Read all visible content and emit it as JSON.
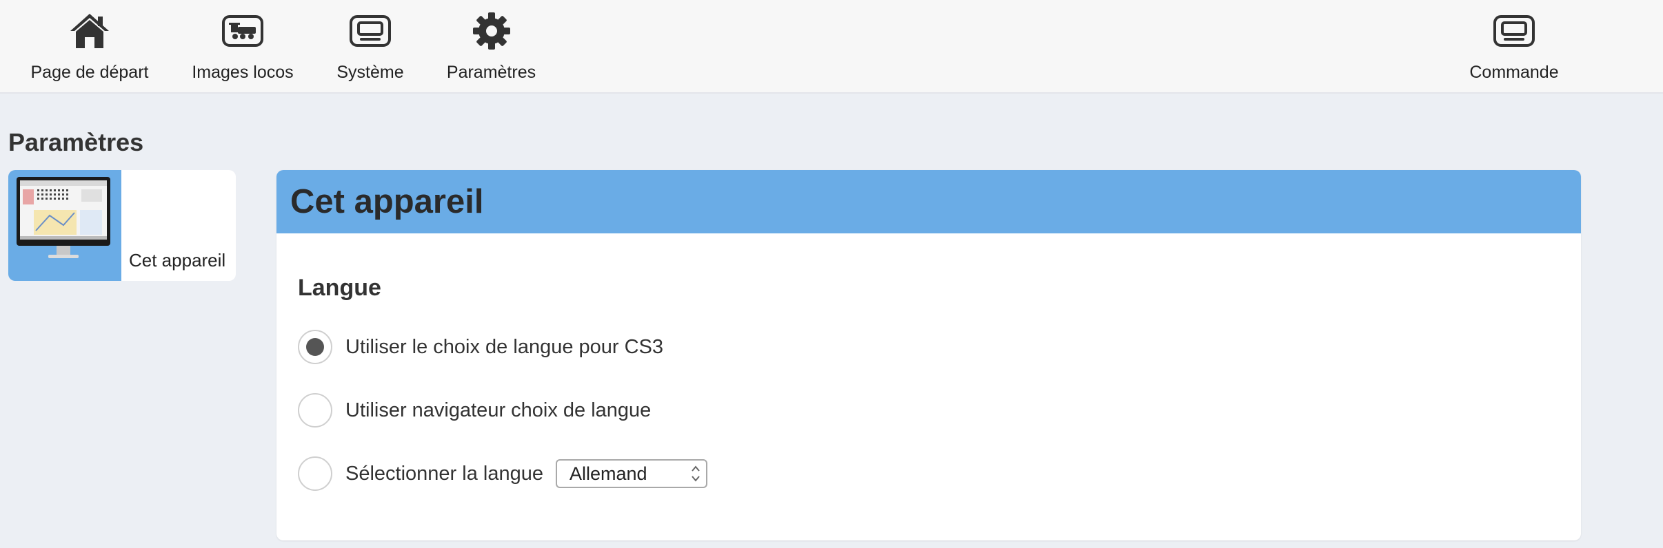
{
  "nav": {
    "items": [
      {
        "label": "Page de départ",
        "icon": "home-icon"
      },
      {
        "label": "Images locos",
        "icon": "locomotive-icon"
      },
      {
        "label": "Système",
        "icon": "device-icon"
      },
      {
        "label": "Paramètres",
        "icon": "gear-icon"
      }
    ],
    "right_item": {
      "label": "Commande",
      "icon": "device-icon"
    }
  },
  "page": {
    "title": "Paramètres"
  },
  "sidebar": {
    "tiles": [
      {
        "label": "Cet appareil",
        "icon": "monitor-icon"
      }
    ]
  },
  "panel": {
    "title": "Cet appareil",
    "section_title": "Langue",
    "options": [
      {
        "label": "Utiliser le choix de langue pour CS3",
        "checked": true
      },
      {
        "label": "Utiliser navigateur choix de langue",
        "checked": false
      },
      {
        "label": "Sélectionner la langue",
        "checked": false
      }
    ],
    "language_select": {
      "value": "Allemand"
    }
  },
  "colors": {
    "accent": "#6aace6",
    "background": "#eceff4",
    "nav_background": "#f7f7f7"
  }
}
